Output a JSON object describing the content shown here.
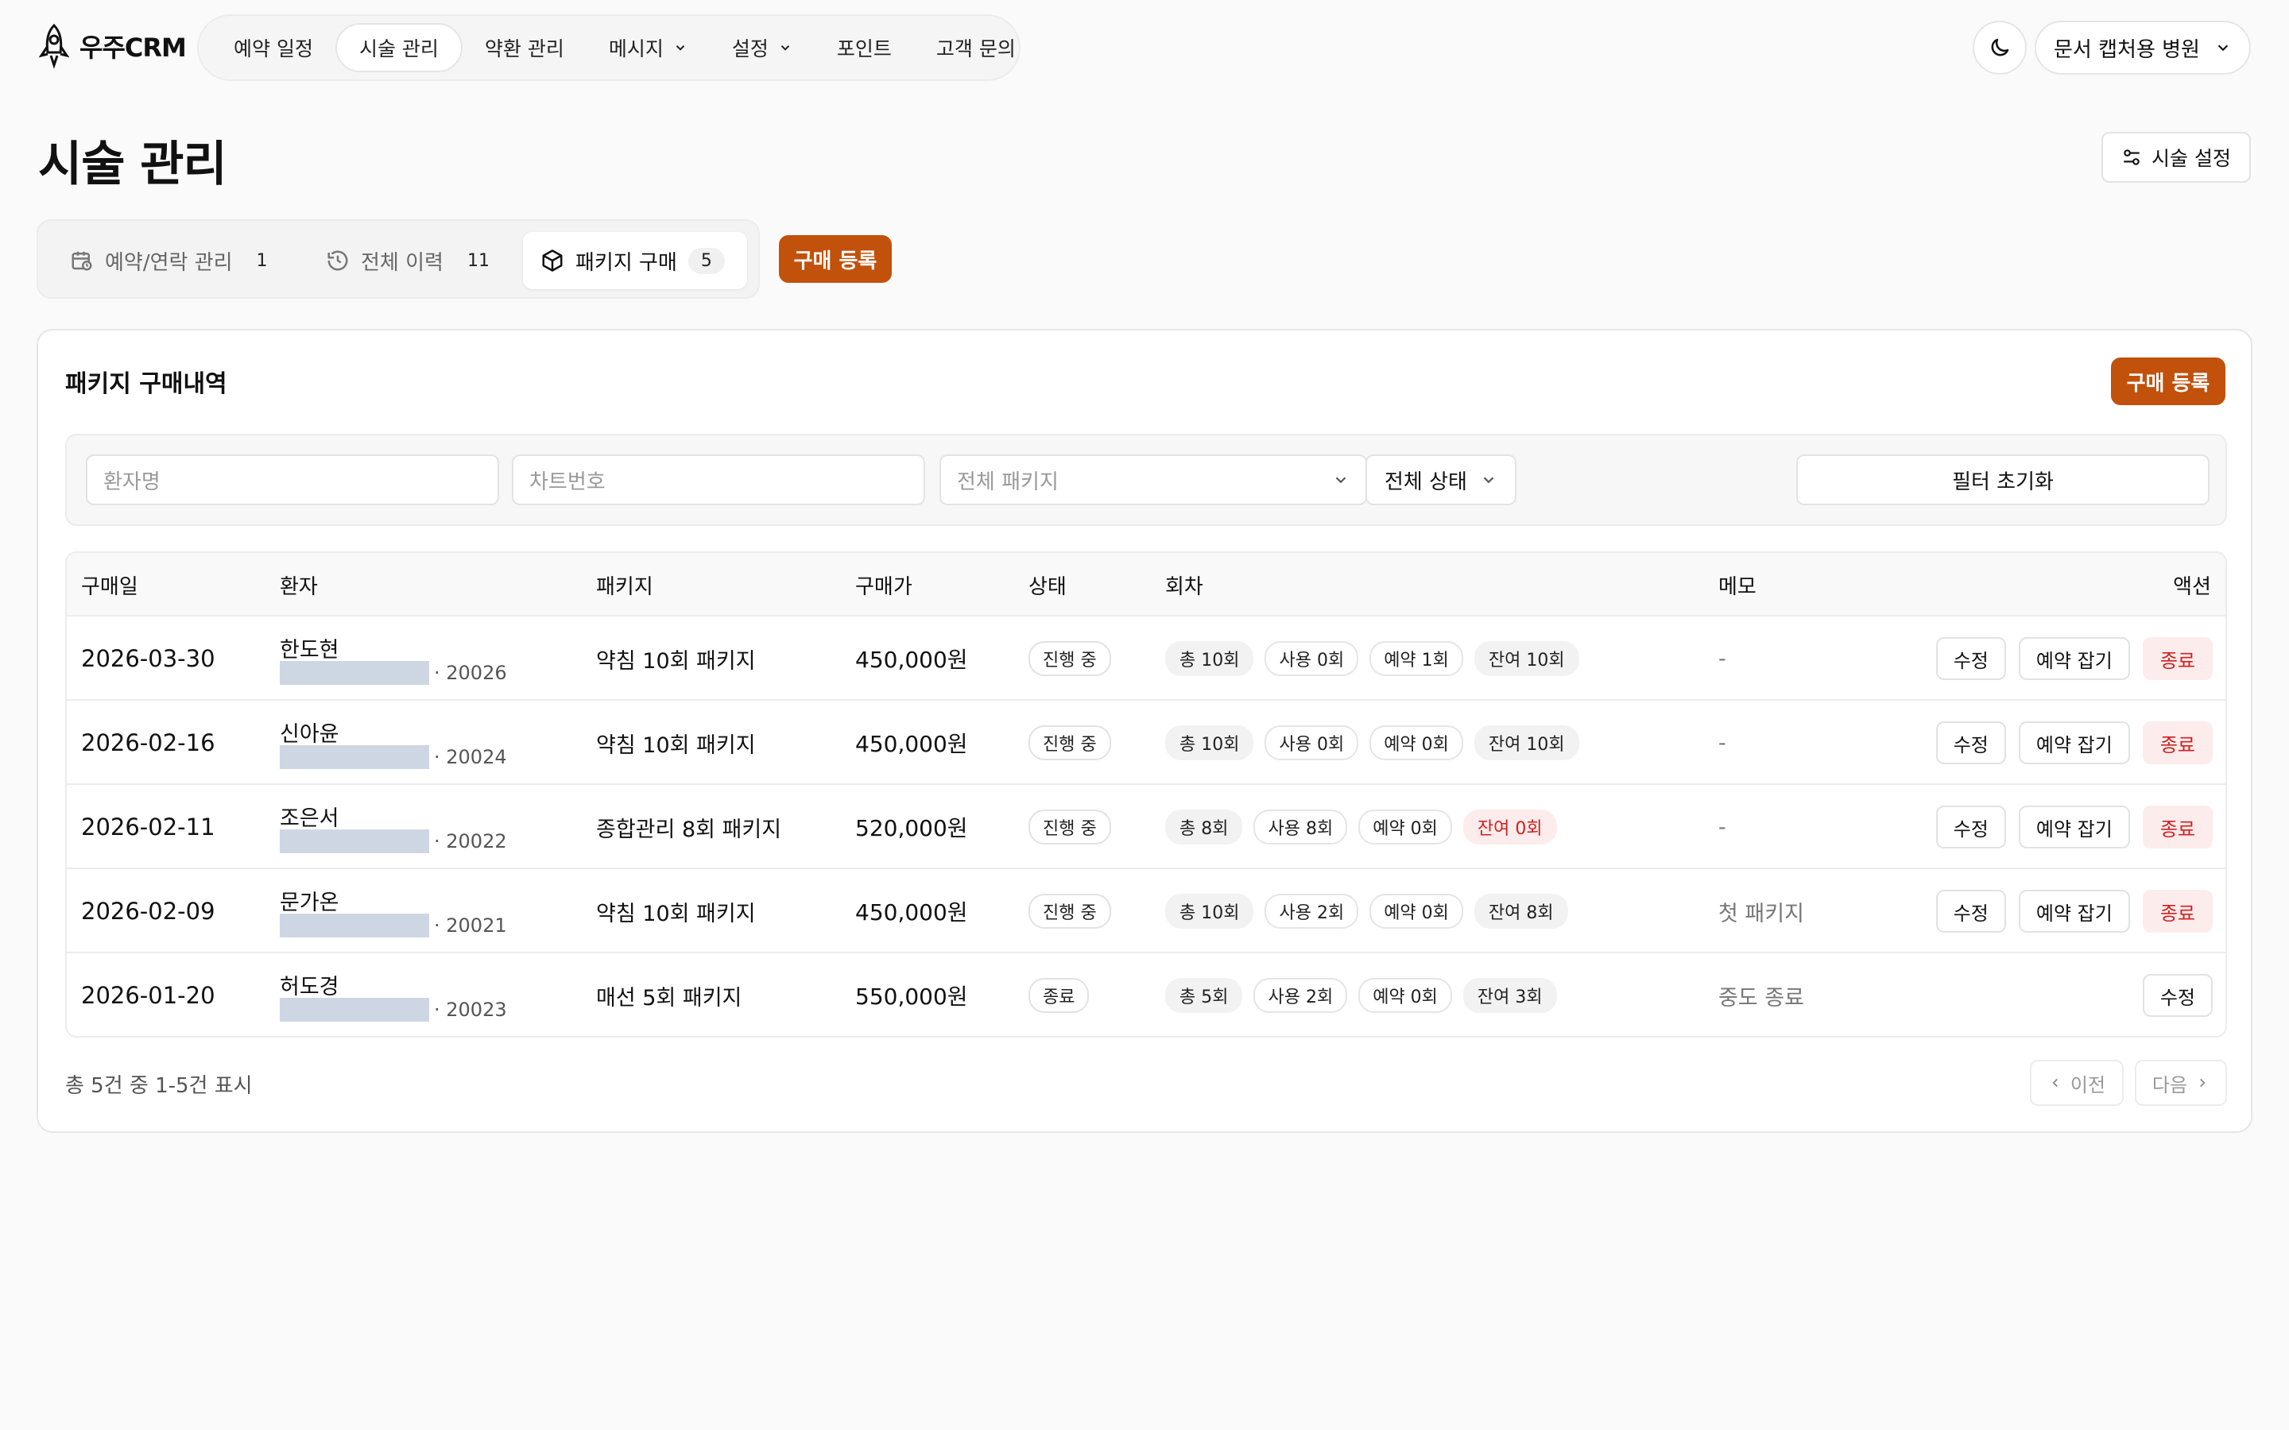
{
  "app": {
    "logo_text": "우주CRM"
  },
  "nav": {
    "items": [
      {
        "label": "예약 일정",
        "active": false,
        "dropdown": false
      },
      {
        "label": "시술 관리",
        "active": true,
        "dropdown": false
      },
      {
        "label": "약환 관리",
        "active": false,
        "dropdown": false
      },
      {
        "label": "메시지",
        "active": false,
        "dropdown": true
      },
      {
        "label": "설정",
        "active": false,
        "dropdown": true
      },
      {
        "label": "포인트",
        "active": false,
        "dropdown": false
      },
      {
        "label": "고객 문의",
        "active": false,
        "dropdown": false
      }
    ],
    "clinic_label": "문서 캡처용 병원"
  },
  "page": {
    "title": "시술 관리",
    "settings_label": "시술 설정"
  },
  "tabs": [
    {
      "label": "예약/연락 관리",
      "count": "1",
      "icon": "calendar-clock-icon"
    },
    {
      "label": "전체 이력",
      "count": "11",
      "icon": "history-icon"
    },
    {
      "label": "패키지 구매",
      "count": "5",
      "icon": "package-icon"
    }
  ],
  "tab_register_label": "구매 등록",
  "card": {
    "title": "패키지 구매내역",
    "register_label": "구매 등록"
  },
  "filters": {
    "patient_placeholder": "환자명",
    "chart_placeholder": "차트번호",
    "package_select": "전체 패키지",
    "status_select": "전체 상태",
    "reset_label": "필터 초기화"
  },
  "table": {
    "headers": {
      "date": "구매일",
      "patient": "환자",
      "package": "패키지",
      "price": "구매가",
      "status": "상태",
      "rounds": "회차",
      "memo": "메모",
      "actions": "액션"
    },
    "rows": [
      {
        "date": "2026-03-30",
        "name": "한도현",
        "chart": "· 20026",
        "package": "약침 10회 패키지",
        "price": "450,000원",
        "status": "진행 중",
        "total": "총 10회",
        "used": "사용 0회",
        "reserved": "예약 1회",
        "remaining": "잔여 10회",
        "remaining_zero": false,
        "memo": "-",
        "edit": "수정",
        "book": "예약 잡기",
        "end": "종료",
        "show_book": true
      },
      {
        "date": "2026-02-16",
        "name": "신아윤",
        "chart": "· 20024",
        "package": "약침 10회 패키지",
        "price": "450,000원",
        "status": "진행 중",
        "total": "총 10회",
        "used": "사용 0회",
        "reserved": "예약 0회",
        "remaining": "잔여 10회",
        "remaining_zero": false,
        "memo": "-",
        "edit": "수정",
        "book": "예약 잡기",
        "end": "종료",
        "show_book": true
      },
      {
        "date": "2026-02-11",
        "name": "조은서",
        "chart": "· 20022",
        "package": "종합관리 8회 패키지",
        "price": "520,000원",
        "status": "진행 중",
        "total": "총 8회",
        "used": "사용 8회",
        "reserved": "예약 0회",
        "remaining": "잔여 0회",
        "remaining_zero": true,
        "memo": "-",
        "edit": "수정",
        "book": "예약 잡기",
        "end": "종료",
        "show_book": true
      },
      {
        "date": "2026-02-09",
        "name": "문가온",
        "chart": "· 20021",
        "package": "약침 10회 패키지",
        "price": "450,000원",
        "status": "진행 중",
        "total": "총 10회",
        "used": "사용 2회",
        "reserved": "예약 0회",
        "remaining": "잔여 8회",
        "remaining_zero": false,
        "memo": "첫 패키지",
        "edit": "수정",
        "book": "예약 잡기",
        "end": "종료",
        "show_book": true
      },
      {
        "date": "2026-01-20",
        "name": "허도경",
        "chart": "· 20023",
        "package": "매선 5회 패키지",
        "price": "550,000원",
        "status": "종료",
        "total": "총 5회",
        "used": "사용 2회",
        "reserved": "예약 0회",
        "remaining": "잔여 3회",
        "remaining_zero": false,
        "memo": "중도 종료",
        "edit": "수정",
        "book": "",
        "end": "",
        "show_book": false
      }
    ]
  },
  "footer": {
    "summary": "총 5건 중 1-5건 표시",
    "prev_label": "이전",
    "next_label": "다음"
  },
  "colors": {
    "accent": "#c2510c",
    "danger": "#d32020",
    "danger_bg": "#fdecec"
  }
}
